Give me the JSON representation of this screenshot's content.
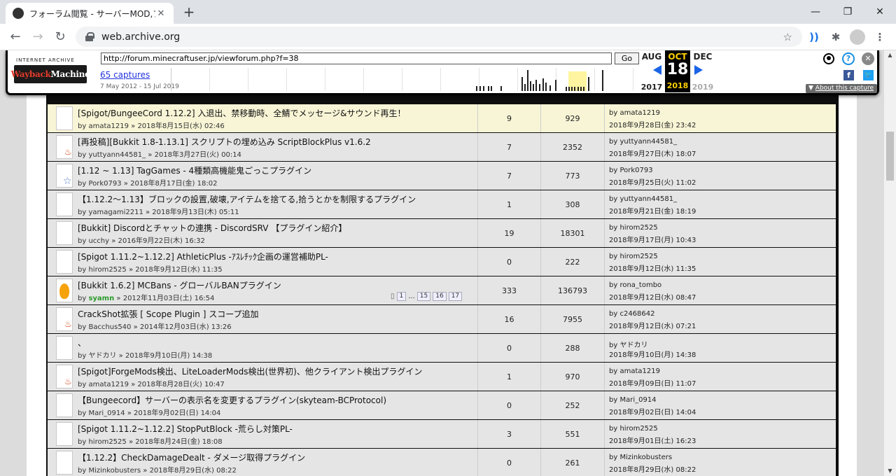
{
  "browser": {
    "tab_title": "フォーラム閲覧 - サーバーMOD,プラグ",
    "url": "web.archive.org"
  },
  "wayback": {
    "logo_top": "INTERNET ARCHIVE",
    "logo_word1": "Wayback",
    "logo_word2": "Machine",
    "url_input": "http://forum.minecraftuser.jp/viewforum.php?f=38",
    "go_label": "Go",
    "captures": "65 captures",
    "date_range": "7 May 2012 - 15 Jul 2019",
    "prev_month": "AUG",
    "cur_month": "OCT",
    "cur_day": "18",
    "next_month": "DEC",
    "prev_year": "2017",
    "cur_year": "2018",
    "next_year": "2019",
    "about": "About this capture"
  },
  "topics": [
    {
      "title": "[Spigot/BungeeCord 1.12.2] 入退出、禁移動時、全鯖でメッセージ&サウンド再生！",
      "author": "amata1219",
      "date": "2018年8月15日(水) 02:46",
      "replies": "9",
      "views": "929",
      "last_by": "amata1219",
      "last_time": "2018年9月28日(金) 23:42",
      "icon": "plain",
      "highlight": true
    },
    {
      "title": "[再投稿][Bukkit 1.8-1.13.1] スクリプトの埋め込み ScriptBlockPlus v1.6.2",
      "author": "yuttyann44581_",
      "date": "2018年3月27日(火) 00:14",
      "replies": "7",
      "views": "2352",
      "last_by": "yuttyann44581_",
      "last_time": "2018年9月27日(木) 18:07",
      "icon": "fire"
    },
    {
      "title": "[1.12 ~ 1.13] TagGames - 4種類高機能鬼ごっこプラグイン",
      "author": "Pork0793",
      "date": "2018年8月17日(金) 18:02",
      "replies": "7",
      "views": "773",
      "last_by": "Pork0793",
      "last_time": "2018年9月25日(火) 11:02",
      "icon": "star"
    },
    {
      "title": "【1.12.2〜1.13】ブロックの設置,破壊,アイテムを捨てる,拾うとかを制限するプラグイン",
      "author": "yamagami2211",
      "date": "2018年9月13日(木) 05:11",
      "replies": "1",
      "views": "308",
      "last_by": "yuttyann44581_",
      "last_time": "2018年9月21日(金) 18:19",
      "icon": "plain"
    },
    {
      "title": "[Bukkit] Discordとチャットの連携 - DiscordSRV 【プラグイン紹介】",
      "author": "ucchy",
      "date": "2016年9月22日(木) 16:32",
      "replies": "19",
      "views": "18301",
      "last_by": "hirom2525",
      "last_time": "2018年9月17日(月) 10:43",
      "icon": "plain"
    },
    {
      "title": "[Spigot 1.11.2~1.12.2] AthleticPlus -ｱｽﾚﾁｯｸ企画の運営補助PL-",
      "author": "hirom2525",
      "date": "2018年9月12日(水) 11:35",
      "replies": "0",
      "views": "222",
      "last_by": "hirom2525",
      "last_time": "2018年9月12日(水) 11:35",
      "icon": "plain"
    },
    {
      "title": "[Bukkit 1.6.2] MCBans - グローバルBANプラグイン",
      "author": "syamn",
      "author_green": true,
      "date": "2012年11月03日(土) 16:54",
      "replies": "333",
      "views": "136793",
      "last_by": "rona_tombo",
      "last_time": "2018年9月12日(水) 08:47",
      "icon": "flame",
      "pages": [
        "1",
        "15",
        "16",
        "17"
      ]
    },
    {
      "title": "CrackShot拡張 [ Scope Plugin ] スコープ追加",
      "author": "Bacchus540",
      "date": "2014年12月03日(水) 13:26",
      "replies": "16",
      "views": "7955",
      "last_by": "c2468642",
      "last_time": "2018年9月12日(水) 07:21",
      "icon": "fire"
    },
    {
      "title": "、",
      "author": "ヤドカリ",
      "date": "2018年9月10日(月) 14:38",
      "replies": "0",
      "views": "288",
      "last_by": "ヤドカリ",
      "last_time": "2018年9月10日(月) 14:38",
      "icon": "plain"
    },
    {
      "title": "[Spigot]ForgeMods検出、LiteLoaderMods検出(世界初)、他クライアント検出プラグイン",
      "author": "amata1219",
      "date": "2018年8月28日(火) 10:47",
      "replies": "1",
      "views": "970",
      "last_by": "amata1219",
      "last_time": "2018年9月09日(日) 11:07",
      "icon": "fire"
    },
    {
      "title": "【Bungeecord】サーバーの表示名を変更するプラグイン(skyteam-BCProtocol)",
      "author": "Mari_0914",
      "date": "2018年9月02日(日) 14:04",
      "replies": "0",
      "views": "252",
      "last_by": "Mari_0914",
      "last_time": "2018年9月02日(日) 14:04",
      "icon": "plain"
    },
    {
      "title": "[Spigot 1.11.2~1.12.2] StopPutBlock -荒らし対策PL-",
      "author": "hirom2525",
      "date": "2018年8月24日(金) 18:08",
      "replies": "3",
      "views": "551",
      "last_by": "hirom2525",
      "last_time": "2018年9月01日(土) 16:23",
      "icon": "plain"
    },
    {
      "title": "【1.12.2】CheckDamageDealt - ダメージ取得プラグイン",
      "author": "Mizinkobusters",
      "date": "2018年8月29日(水) 08:22",
      "replies": "0",
      "views": "261",
      "last_by": "Mizinkobusters",
      "last_time": "2018年8月29日(水) 08:22",
      "icon": "plain"
    }
  ]
}
